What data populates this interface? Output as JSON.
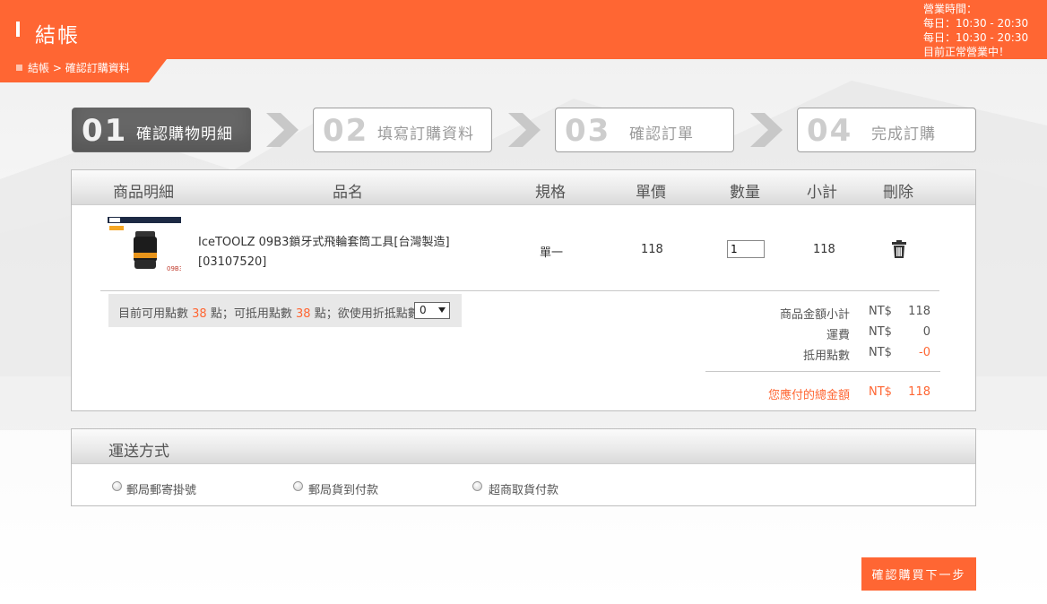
{
  "header": {
    "title": "結帳",
    "hours_label": "營業時間：",
    "hours_line1": "每日：10:30 - 20:30",
    "hours_line2": "每日：10:30 - 20:30",
    "open_status": "目前正常營業中！"
  },
  "breadcrumb": {
    "item1": "結帳",
    "sep": ">",
    "item2": "確認訂購資料"
  },
  "steps": [
    {
      "num": "01",
      "label": "確認購物明細",
      "active": true
    },
    {
      "num": "02",
      "label": "填寫訂購資料",
      "active": false
    },
    {
      "num": "03",
      "label": "確認訂單",
      "active": false
    },
    {
      "num": "04",
      "label": "完成訂購",
      "active": false
    }
  ],
  "cart": {
    "columns": {
      "detail": "商品明細",
      "name": "品名",
      "spec": "規格",
      "price": "單價",
      "qty": "數量",
      "subtotal": "小計",
      "delete": "刪除"
    },
    "items": [
      {
        "name_line1": "IceTOOLZ 09B3鎖牙式飛輪套筒工具[台灣製造]",
        "name_line2": "[03107520]",
        "spec": "單一",
        "price": "118",
        "qty": "1",
        "subtotal": "118",
        "image_text": "09B3"
      }
    ],
    "points": {
      "text1": "目前可用點數",
      "available": "38",
      "text2": "點；可抵用點數",
      "usable": "38",
      "text3": "點；欲使用折抵點數",
      "selected": "0"
    },
    "summary": {
      "subtotal_label": "商品金額小計",
      "subtotal_currency": "NT$",
      "subtotal_value": "118",
      "shipping_label": "運費",
      "shipping_currency": "NT$",
      "shipping_value": "0",
      "points_label": "抵用點數",
      "points_currency": "NT$",
      "points_value": "-0",
      "total_label": "您應付的總金額",
      "total_currency": "NT$",
      "total_value": "118"
    }
  },
  "shipping": {
    "title": "運送方式",
    "options": [
      "郵局郵寄掛號",
      "郵局貨到付款",
      "超商取貨付款"
    ]
  },
  "next_button": "確認購買下一步",
  "colors": {
    "accent": "#ff6633",
    "active_step": "#666666"
  }
}
